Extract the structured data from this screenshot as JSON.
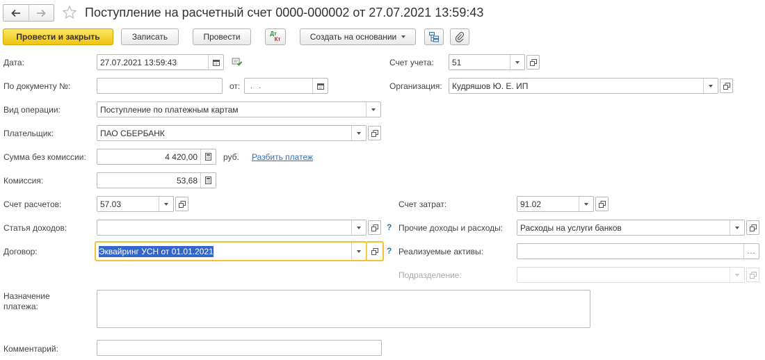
{
  "header": {
    "title": "Поступление на расчетный счет 0000-000002 от 27.07.2021 13:59:43"
  },
  "toolbar": {
    "post_close": "Провести и закрыть",
    "save": "Записать",
    "post": "Провести",
    "dtkt_top": "Дт",
    "dtkt_bottom": "Кт",
    "create_based": "Создать на основании"
  },
  "fields": {
    "date": {
      "label": "Дата:",
      "value": "27.07.2021 13:59:43"
    },
    "doc_number": {
      "label": "По документу №:",
      "value": ""
    },
    "doc_from": {
      "label": "от:",
      "value": " .  ."
    },
    "operation": {
      "label": "Вид операции:",
      "value": "Поступление по платежным картам"
    },
    "payer": {
      "label": "Плательщик:",
      "value": "ПАО СБЕРБАНК"
    },
    "amount": {
      "label": "Сумма без комиссии:",
      "value": "4 420,00",
      "currency": "руб.",
      "split_link": "Разбить платеж"
    },
    "commission": {
      "label": "Комиссия:",
      "value": "53,68"
    },
    "settlement_account": {
      "label": "Счет расчетов:",
      "value": "57.03"
    },
    "income_item": {
      "label": "Статья доходов:",
      "value": ""
    },
    "contract": {
      "label": "Договор:",
      "value": "Эквайринг УСН от 01.01.2021"
    },
    "account": {
      "label": "Счет учета:",
      "value": "51"
    },
    "organization": {
      "label": "Организация:",
      "value": "Кудряшов Ю. Е. ИП"
    },
    "cost_account": {
      "label": "Счет затрат:",
      "value": "91.02"
    },
    "other_income_expense": {
      "label": "Прочие доходы и расходы:",
      "value": "Расходы на услуги банков"
    },
    "sold_assets": {
      "label": "Реализуемые активы:",
      "value": ""
    },
    "department": {
      "label": "Подразделение:",
      "value": ""
    },
    "purpose": {
      "label": "Назначение платежа:",
      "value": ""
    },
    "comment": {
      "label": "Комментарий:",
      "value": ""
    }
  },
  "help_mark": "?",
  "colors": {
    "primary_button": "#f5d12a",
    "link": "#2f6fb3",
    "focus_border": "#f1c232",
    "selection": "#3366cc"
  }
}
